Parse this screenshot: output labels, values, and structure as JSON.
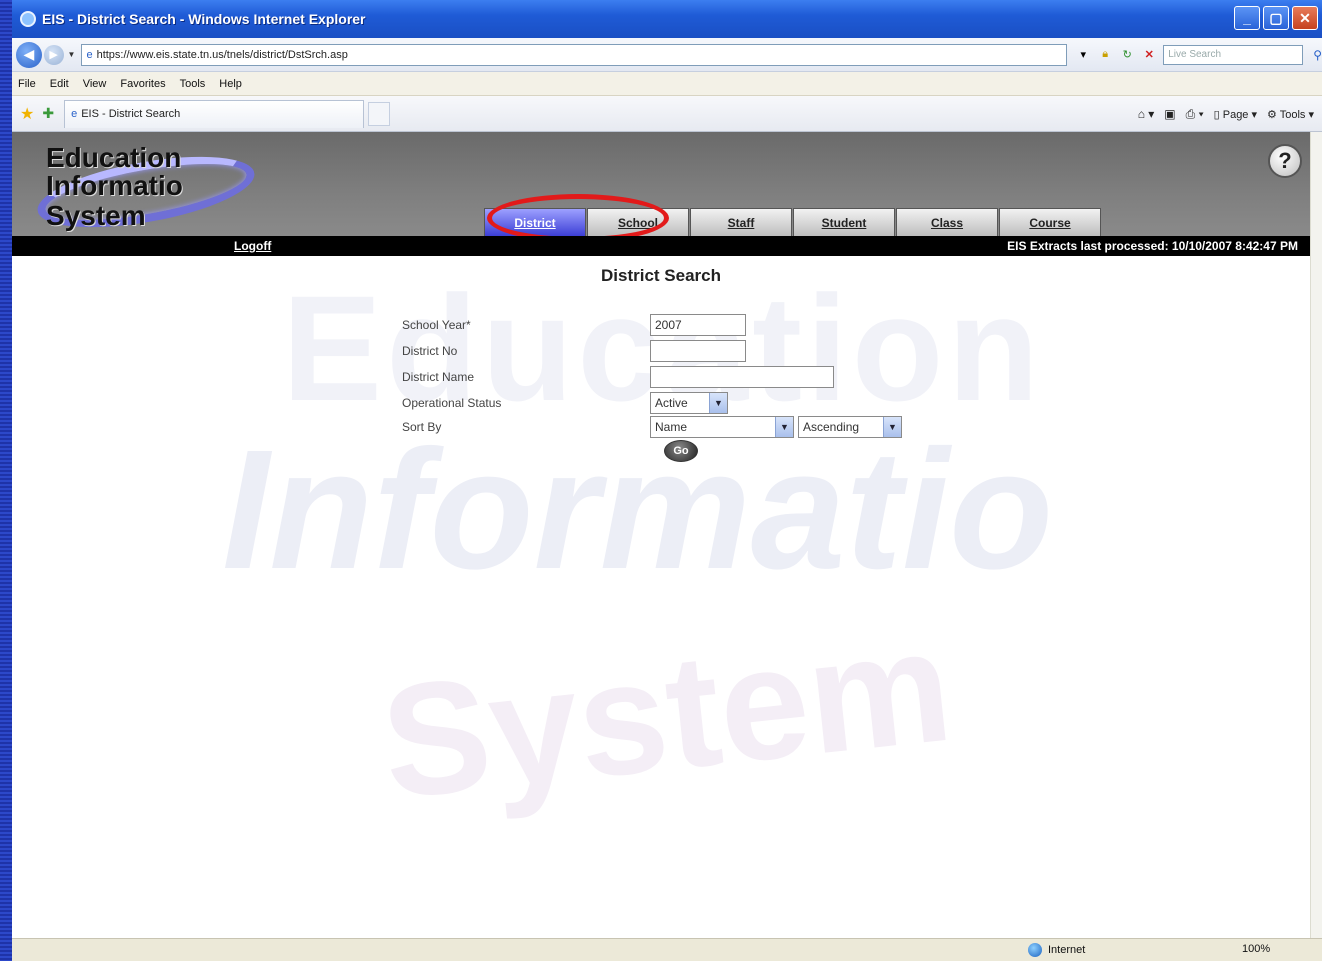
{
  "window": {
    "title": "EIS - District Search - Windows Internet Explorer",
    "minimize": "_",
    "maximize": "▢",
    "close": "✕"
  },
  "address": {
    "url": "https://www.eis.state.tn.us/tnels/district/DstSrch.asp",
    "search_placeholder": "Live Search"
  },
  "menu": [
    "File",
    "Edit",
    "View",
    "Favorites",
    "Tools",
    "Help"
  ],
  "browser_tab": {
    "title": "EIS - District Search"
  },
  "command_bar": {
    "page_label": "Page",
    "tools_label": "Tools"
  },
  "app": {
    "logo": [
      "Education",
      "Informatio",
      "System"
    ],
    "help": "?",
    "tabs": [
      {
        "label": "District",
        "active": true
      },
      {
        "label": "School",
        "active": false
      },
      {
        "label": "Staff",
        "active": false
      },
      {
        "label": "Student",
        "active": false
      },
      {
        "label": "Class",
        "active": false
      },
      {
        "label": "Course",
        "active": false
      }
    ],
    "logoff": "Logoff",
    "extracts": "EIS Extracts last processed: 10/10/2007 8:42:47 PM"
  },
  "form": {
    "title": "District Search",
    "school_year_label": "School Year*",
    "school_year_value": "2007",
    "district_no_label": "District No",
    "district_no_value": "",
    "district_name_label": "District Name",
    "district_name_value": "",
    "op_status_label": "Operational Status",
    "op_status_value": "Active",
    "sort_by_label": "Sort By",
    "sort_by_value": "Name",
    "sort_order_value": "Ascending",
    "go_label": "Go"
  },
  "status": {
    "zone": "Internet",
    "zoom": "100%"
  },
  "colors": {
    "highlight": "#e21a1a",
    "active_tab": "#3c3fd6",
    "header_gray": "#7f7f7f"
  }
}
